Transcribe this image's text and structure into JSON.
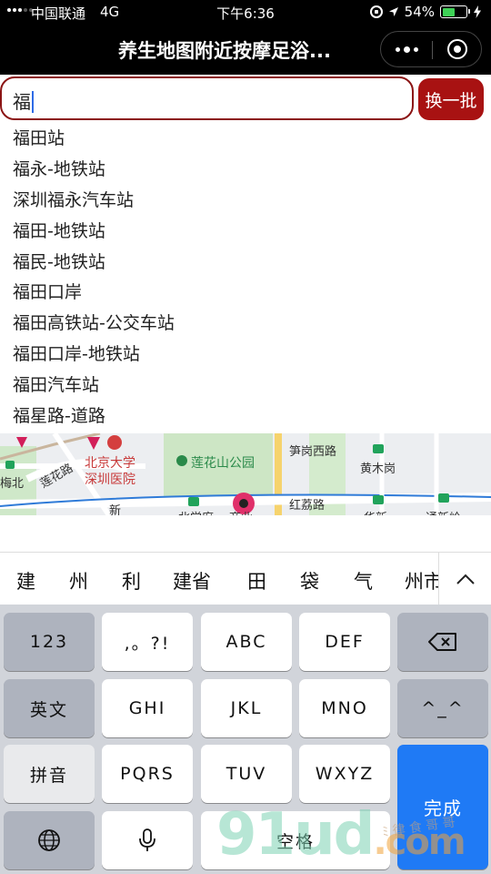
{
  "status_bar": {
    "carrier": "中国联通",
    "network": "4G",
    "time": "下午6:36",
    "battery": "54%",
    "battery_level": 0.54,
    "battery_color": "#3fd257"
  },
  "title_bar": {
    "title": "养生地图附近按摩足浴...",
    "more_icon": "more-dots-icon",
    "close_icon": "capsule-close-icon"
  },
  "search": {
    "value": "福",
    "button_label": "换一批",
    "accent_color": "#a81212"
  },
  "suggestions": [
    "福田站",
    "福永-地铁站",
    "深圳福永汽车站",
    "福田-地铁站",
    "福民-地铁站",
    "福田口岸",
    "福田高铁站-公交车站",
    "福田口岸-地铁站",
    "福田汽车站",
    "福星路-道路"
  ],
  "map": {
    "labels": [
      "北京大学",
      "深圳医院",
      "莲花山公园",
      "笋岗西路",
      "黄木岗",
      "莲花路",
      "梅北",
      "红荔路",
      "新",
      "北学府",
      "商业",
      "华新",
      "通新岭"
    ]
  },
  "candidates": [
    "建",
    "州",
    "利",
    "建省",
    "田",
    "袋",
    "气",
    "州市"
  ],
  "keyboard": {
    "rows": [
      [
        "123",
        ",。?!",
        "ABC",
        "DEF"
      ],
      [
        "英文",
        "GHI",
        "JKL",
        "MNO",
        "^_^"
      ],
      [
        "拼音",
        "PQRS",
        "TUV",
        "WXYZ"
      ],
      [
        "空格"
      ]
    ],
    "done_label": "完成",
    "done_color": "#1f7af5"
  },
  "watermark": {
    "text": "91ud",
    "suffix": ".com",
    "small": "ﾐ 律 食 哥 哥"
  }
}
